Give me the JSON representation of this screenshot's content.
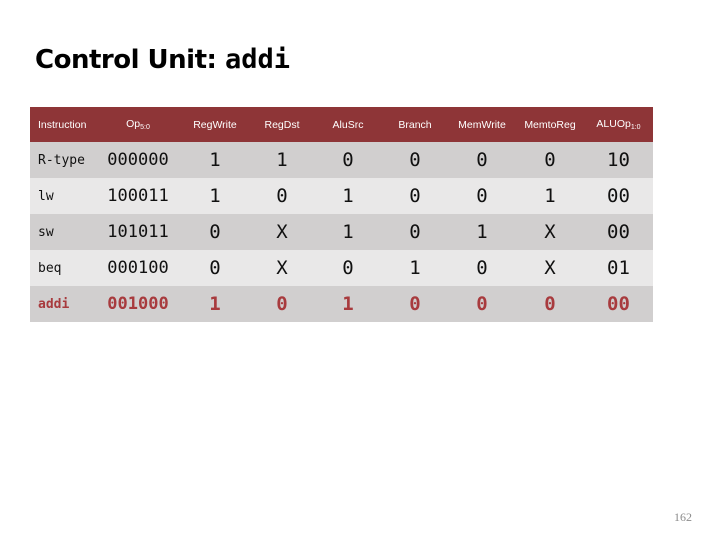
{
  "slide": {
    "title_text": "Control Unit: ",
    "title_code": "addi",
    "page_number": "162"
  },
  "table": {
    "headers": [
      {
        "label": "Instruction",
        "sub": ""
      },
      {
        "label": "Op",
        "sub": "5:0"
      },
      {
        "label": "RegWrite",
        "sub": ""
      },
      {
        "label": "RegDst",
        "sub": ""
      },
      {
        "label": "AluSrc",
        "sub": ""
      },
      {
        "label": "Branch",
        "sub": ""
      },
      {
        "label": "MemWrite",
        "sub": ""
      },
      {
        "label": "MemtoReg",
        "sub": ""
      },
      {
        "label": "ALUOp",
        "sub": "1:0"
      }
    ],
    "rows": [
      {
        "instruction": "R-type",
        "op": "000000",
        "regwrite": "1",
        "regdst": "1",
        "alusrc": "0",
        "branch": "0",
        "memwrite": "0",
        "memtoreg": "0",
        "aluop": "10"
      },
      {
        "instruction": "lw",
        "op": "100011",
        "regwrite": "1",
        "regdst": "0",
        "alusrc": "1",
        "branch": "0",
        "memwrite": "0",
        "memtoreg": "1",
        "aluop": "00"
      },
      {
        "instruction": "sw",
        "op": "101011",
        "regwrite": "0",
        "regdst": "X",
        "alusrc": "1",
        "branch": "0",
        "memwrite": "1",
        "memtoreg": "X",
        "aluop": "00"
      },
      {
        "instruction": "beq",
        "op": "000100",
        "regwrite": "0",
        "regdst": "X",
        "alusrc": "0",
        "branch": "1",
        "memwrite": "0",
        "memtoreg": "X",
        "aluop": "01"
      },
      {
        "instruction": "addi",
        "op": "001000",
        "regwrite": "1",
        "regdst": "0",
        "alusrc": "1",
        "branch": "0",
        "memwrite": "0",
        "memtoreg": "0",
        "aluop": "00"
      }
    ],
    "highlighted_row": "addi"
  },
  "colors": {
    "header_bg": "#8e3537",
    "row_dark": "#d1cfcf",
    "row_light": "#e9e8e8",
    "highlight_text": "#a83b3e"
  }
}
